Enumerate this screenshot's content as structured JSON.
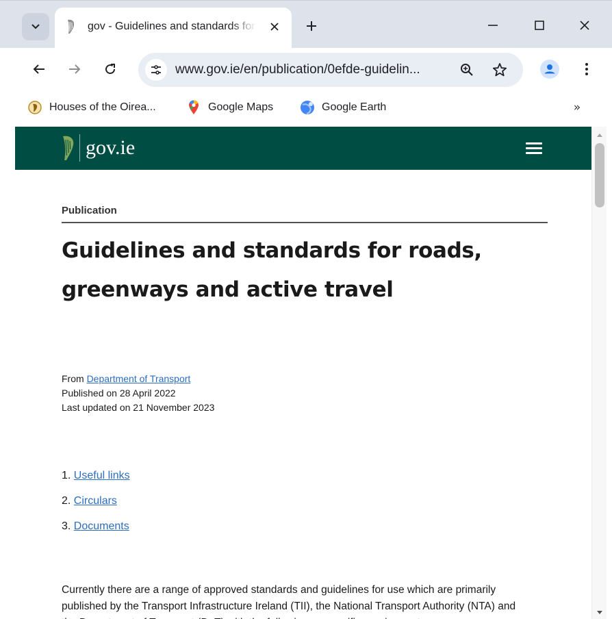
{
  "browser": {
    "tab": {
      "title": "gov - Guidelines and standards for roads, greenways and active travel"
    },
    "address_bar": {
      "url": "www.gov.ie/en/publication/0efde-guidelin..."
    },
    "bookmarks": [
      {
        "label": "Houses of the Oirea..."
      },
      {
        "label": "Google Maps"
      },
      {
        "label": "Google Earth"
      }
    ],
    "bookmarks_overflow": "»"
  },
  "site": {
    "logo_text": "gov.ie",
    "brand_color": "#004d44"
  },
  "page": {
    "category": "Publication",
    "title": "Guidelines and standards for roads, greenways and active travel",
    "meta": {
      "from_prefix": "From",
      "from_link": "Department of Transport",
      "published": "Published on 28 April 2022",
      "updated": "Last updated on 21 November 2023"
    },
    "toc": [
      {
        "num": "1.",
        "label": "Useful links"
      },
      {
        "num": "2.",
        "label": "Circulars"
      },
      {
        "num": "3.",
        "label": "Documents"
      }
    ],
    "intro": "Currently there are a range of approved standards and guidelines for use which are primarily published by the Transport Infrastructure Ireland (TII), the National Transport Authority (NTA) and the Department of Transport (DoT) with the following as specific requirements: -",
    "link_color": "#2c6dbf"
  }
}
